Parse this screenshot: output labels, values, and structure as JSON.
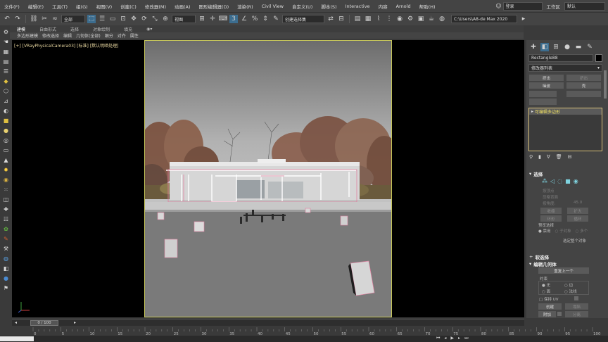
{
  "menu": {
    "items": [
      "文件(F)",
      "编辑(E)",
      "工具(T)",
      "组(G)",
      "视图(V)",
      "创建(C)",
      "修改器(M)",
      "动画(A)",
      "图形编辑器(D)",
      "渲染(R)",
      "Civil View",
      "自定义(U)",
      "脚本(S)",
      "Interactive",
      "内容",
      "Arnold",
      "帮助(H)"
    ],
    "user_label": "登录",
    "workspace_label": "工作区",
    "workspace_value": "默认"
  },
  "toolbar": {
    "filter_value": "全部",
    "view_value": "视图",
    "selection_set_placeholder": "创建选择集",
    "path_value": "C:\\Users\\A8-de Max 2020"
  },
  "ribbon": {
    "tabs": [
      "建模",
      "自由形式",
      "选择",
      "对象绘制",
      "填充"
    ],
    "active_tab": "建模",
    "subtools": [
      "多边形建模",
      "修改选择",
      "编辑",
      "几何体(全部)",
      "细分",
      "对齐",
      "属性"
    ]
  },
  "viewport": {
    "label": "[+] [VRayPhysicalCamera03] [标准] [默认明暗处理]"
  },
  "panel": {
    "object_name": "Rectangle88",
    "modifier_list_label": "修改器列表",
    "btn_row1": [
      "挤出",
      "挤出"
    ],
    "btn_row2": [
      "噪波",
      "壳"
    ],
    "stack_item": "可编辑多边形",
    "selection_rollout": "选择",
    "sel_opts": [
      "按顶点",
      "忽略背面",
      "按角度:",
      "45.0"
    ],
    "shrink": "收缩",
    "grow": "扩大",
    "ring": "环形",
    "loop": "循环",
    "preview_label": "预览选择",
    "preview_opts": [
      "禁用",
      "子对象",
      "多个"
    ],
    "select_whole": "选定整个对象",
    "soft_sel": "软选择",
    "edit_geo": "编辑几何体",
    "repeat_last": "重复上一个",
    "constraint_label": "约束",
    "constraints": [
      "无",
      "边",
      "面",
      "法线"
    ],
    "preserve_uv": "保持 UV",
    "create": "创建",
    "collapse": "塌陷",
    "attach": "附加",
    "detach": "分离"
  },
  "timeline": {
    "frame_display": "0 / 100",
    "ticks": [
      "0",
      "5",
      "10",
      "15",
      "20",
      "25",
      "30",
      "35",
      "40",
      "45",
      "50",
      "55",
      "60",
      "65",
      "70",
      "75",
      "80",
      "85",
      "90",
      "95",
      "100"
    ]
  },
  "colors": {
    "accent": "#3c6d8f",
    "viewport_border": "#c8c85a",
    "stack_border": "#d8c078",
    "object_swatch": "#000000"
  },
  "icons": {
    "undo": "undo-icon",
    "redo": "redo-icon",
    "link": "link-icon",
    "unlink": "unlink-icon",
    "select": "select-icon",
    "move": "move-icon",
    "rotate": "rotate-icon",
    "scale": "scale-icon",
    "snap": "snap-icon",
    "render": "render-icon"
  }
}
